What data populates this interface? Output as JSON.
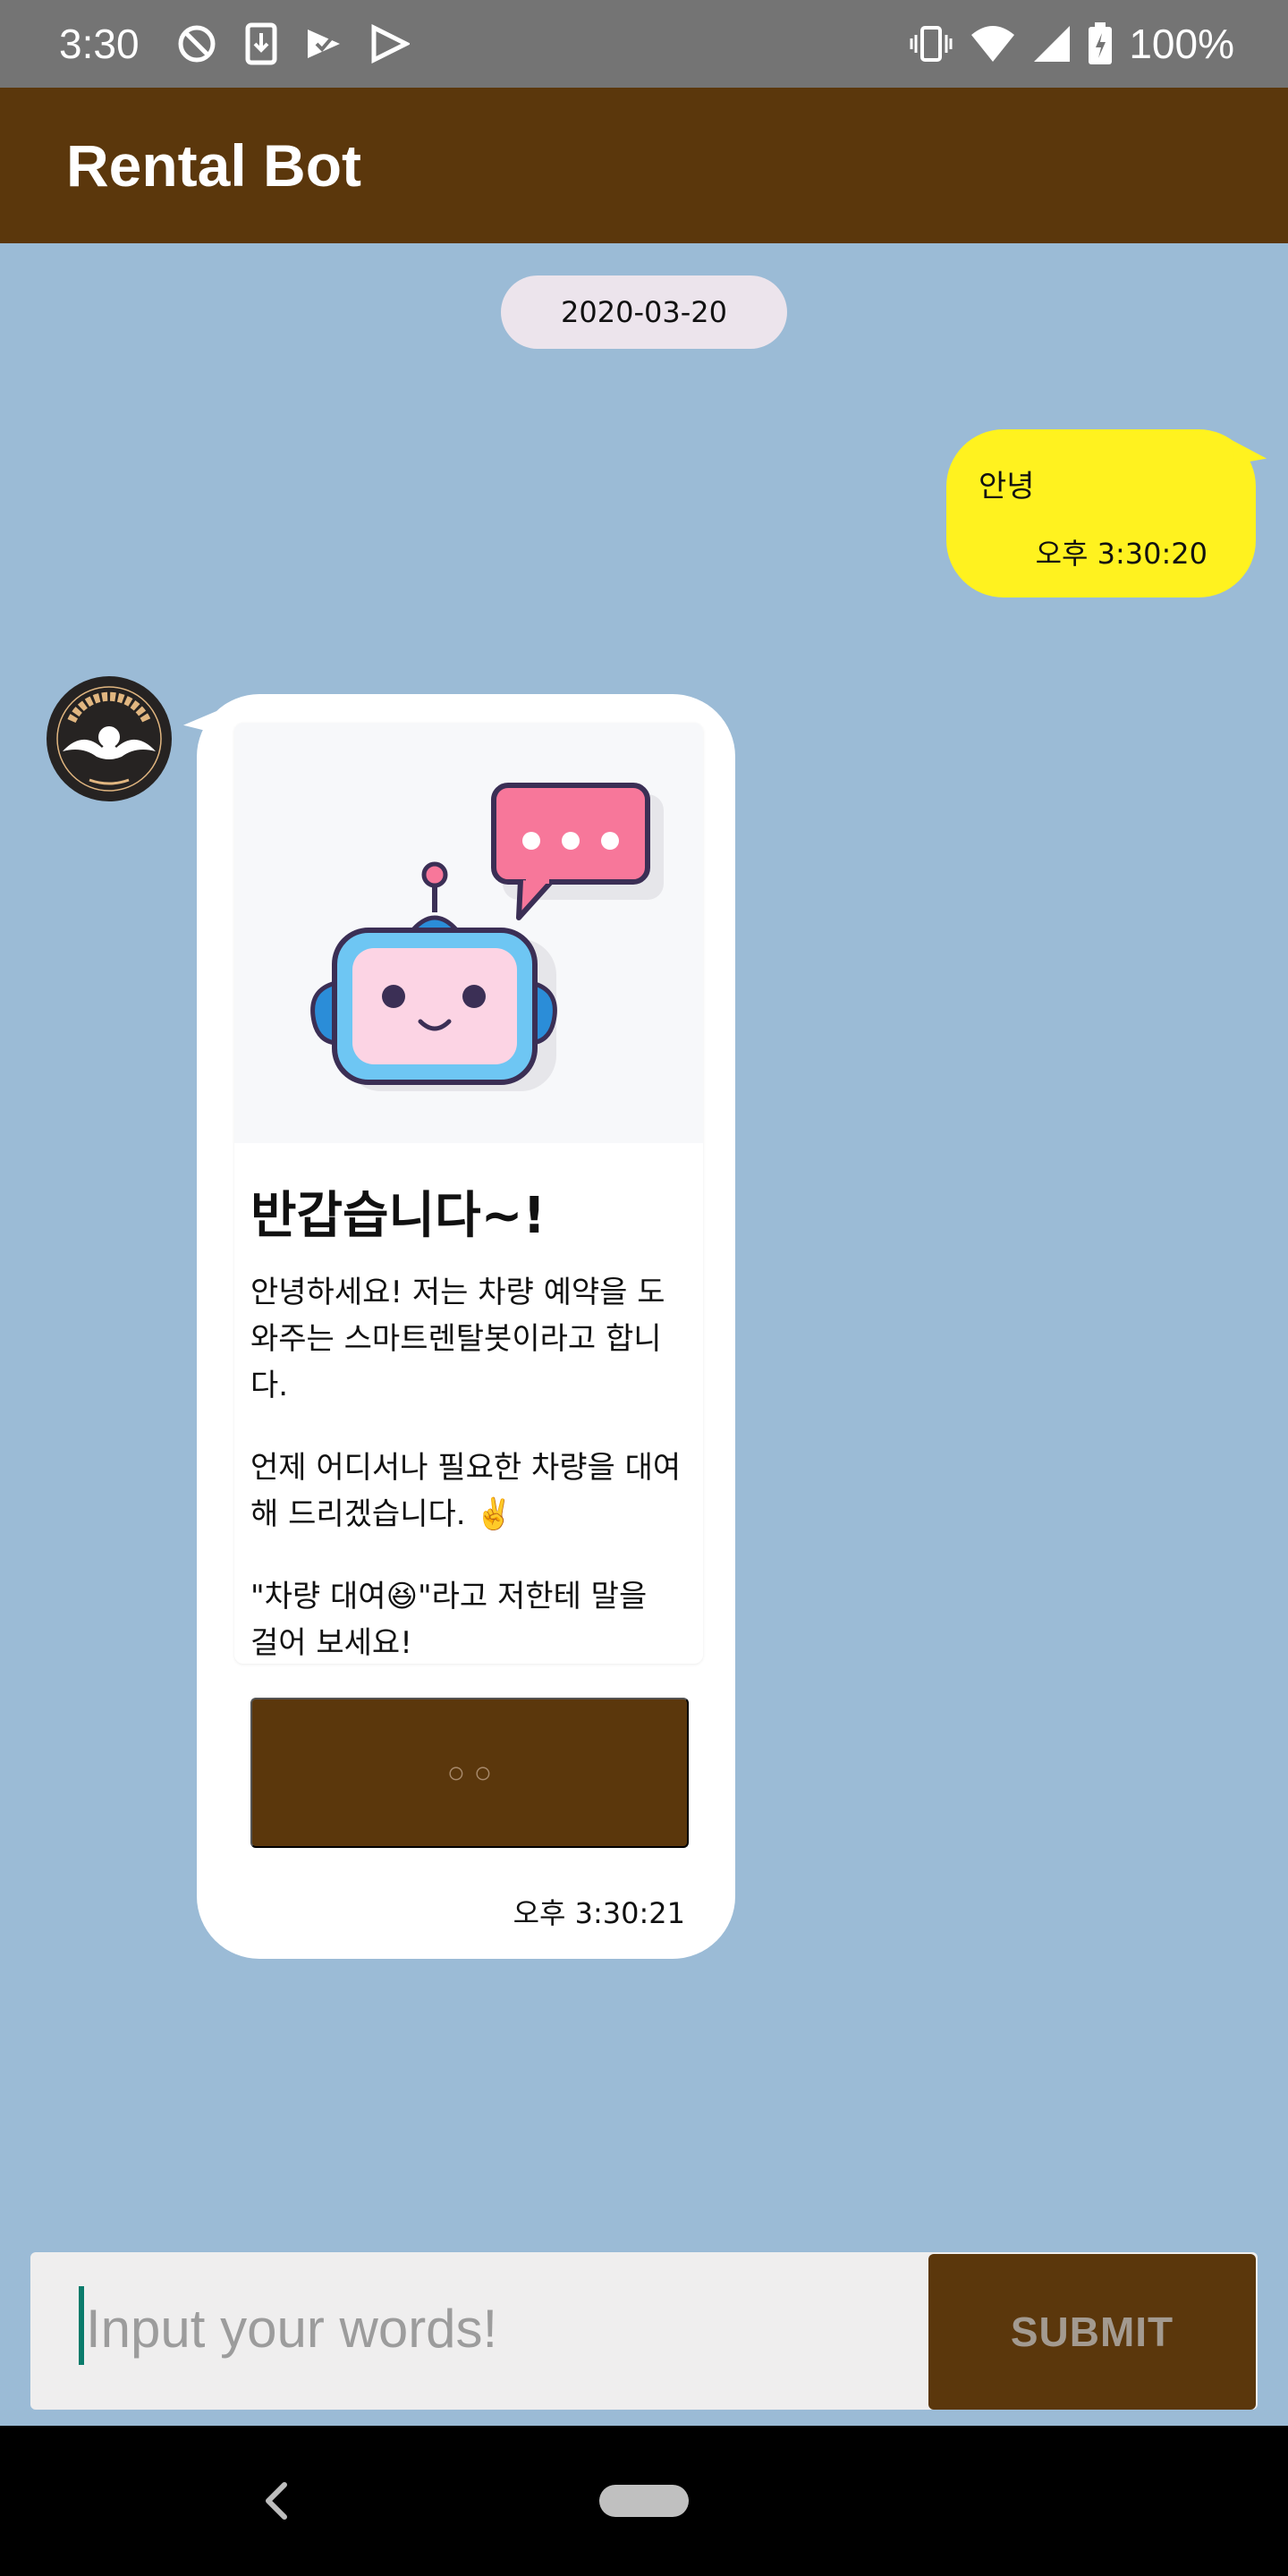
{
  "status_bar": {
    "time": "3:30",
    "battery": "100%",
    "left_icons": [
      "location-off-icon",
      "download-icon",
      "checked-icon",
      "play-store-icon"
    ],
    "right_icons": [
      "vibrate-icon",
      "wifi-icon",
      "signal-icon",
      "battery-icon"
    ]
  },
  "app_bar": {
    "title": "Rental Bot",
    "color": "#5b370c"
  },
  "chat": {
    "date": "2020-03-20",
    "user_message": {
      "text": "안녕",
      "time": "오후 3:30:20",
      "color": "#fff21f"
    },
    "bot_message": {
      "avatar": "angel-in-us-logo",
      "card": {
        "title": "반갑습니다~!",
        "paragraphs": [
          "안녕하세요! 저는 차량 예약을 도와주는 스마트렌탈봇이라고 합니다.",
          "언제 어디서나 필요한 차량을 대여해 드리겠습니다. ✌️",
          "\"차량 대여😆\"라고 저한테 말을 걸어 보세요!"
        ],
        "button_label": "○ ○"
      },
      "time": "오후 3:30:21"
    }
  },
  "input": {
    "placeholder": "Input your words!",
    "value": "",
    "submit_label": "SUBMIT"
  },
  "background_color": "#9bbbd6"
}
